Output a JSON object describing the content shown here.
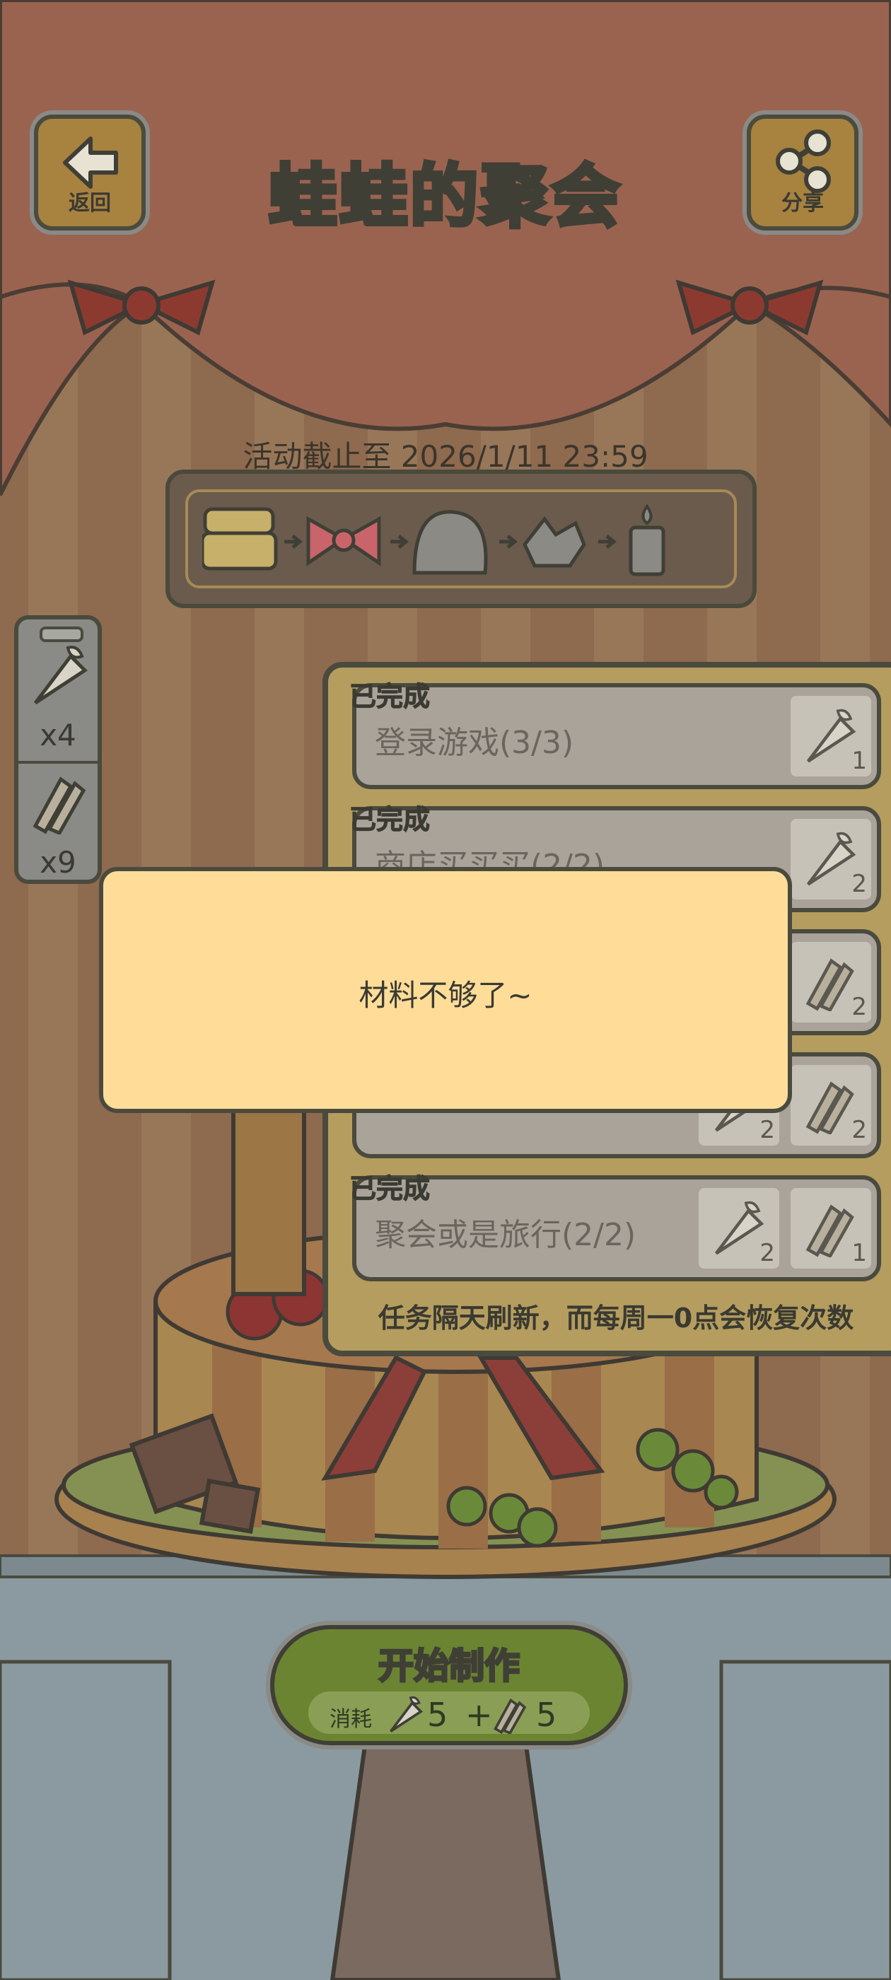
{
  "header": {
    "title": "蛙蛙的聚会",
    "back_label": "返回",
    "share_label": "分享"
  },
  "deadline": "活动截止至 2026/1/11 23:59",
  "inventory": [
    {
      "icon": "piping-bag-icon",
      "count": "x4"
    },
    {
      "icon": "carrot-bundle-icon",
      "count": "x9"
    }
  ],
  "tasks": {
    "items": [
      {
        "status": "已完成",
        "name": "登录游戏(3/3)",
        "rewards": [
          "1"
        ]
      },
      {
        "status": "已完成",
        "name": "商店买买买(2/2)",
        "rewards": [
          "2"
        ]
      },
      {
        "status": "",
        "name": "",
        "rewards": [
          "2"
        ]
      },
      {
        "status": "",
        "name": "",
        "rewards": [
          "2",
          "2"
        ]
      },
      {
        "status": "已完成",
        "name": "聚会或是旅行(2/2)",
        "rewards": [
          "2",
          "1"
        ]
      }
    ],
    "note": "任务隔天刷新，而每周一0点会恢复次数"
  },
  "toast": {
    "text": "材料不够了~"
  },
  "make": {
    "label": "开始制作",
    "cost_prefix": "消耗",
    "cost_a": "5",
    "plus": "+",
    "cost_b": "5"
  },
  "colors": {
    "curtain": "#9a6350",
    "panel": "#b49d5e",
    "toast": "#ffdd99",
    "button": "#6b8432"
  }
}
